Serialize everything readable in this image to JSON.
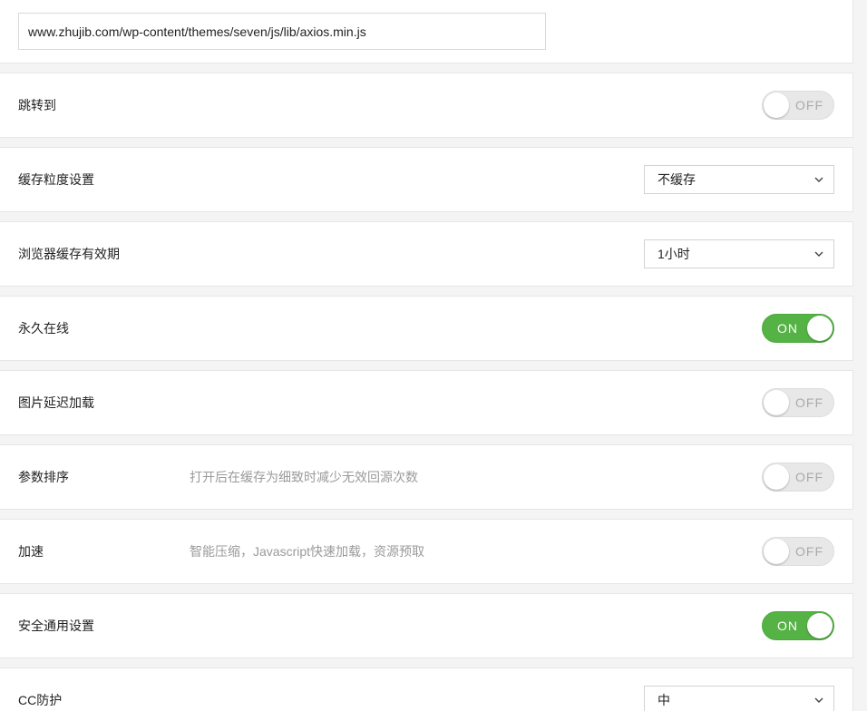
{
  "url_field": {
    "value": "www.zhujib.com/wp-content/themes/seven/js/lib/axios.min.js"
  },
  "settings": {
    "redirect": {
      "label": "跳转到",
      "toggle": "OFF"
    },
    "cache_granularity": {
      "label": "缓存粒度设置",
      "selected": "不缓存"
    },
    "browser_cache_ttl": {
      "label": "浏览器缓存有效期",
      "selected": "1小时"
    },
    "always_online": {
      "label": "永久在线",
      "toggle": "ON"
    },
    "image_lazy_load": {
      "label": "图片延迟加载",
      "toggle": "OFF"
    },
    "param_sort": {
      "label": "参数排序",
      "description": "打开后在缓存为细致时减少无效回源次数",
      "toggle": "OFF"
    },
    "acceleration": {
      "label": "加速",
      "description": "智能压缩，Javascript快速加载，资源预取",
      "toggle": "OFF"
    },
    "security_general": {
      "label": "安全通用设置",
      "toggle": "ON"
    },
    "cc_protection": {
      "label": "CC防护",
      "selected": "中"
    }
  },
  "colors": {
    "toggle_on": "#55b245",
    "toggle_off": "#e8e8e8",
    "description_text": "#9a9a9a"
  },
  "icons": {
    "select_arrow": "chevron-down-icon",
    "toggle_knob": "toggle-knob"
  }
}
